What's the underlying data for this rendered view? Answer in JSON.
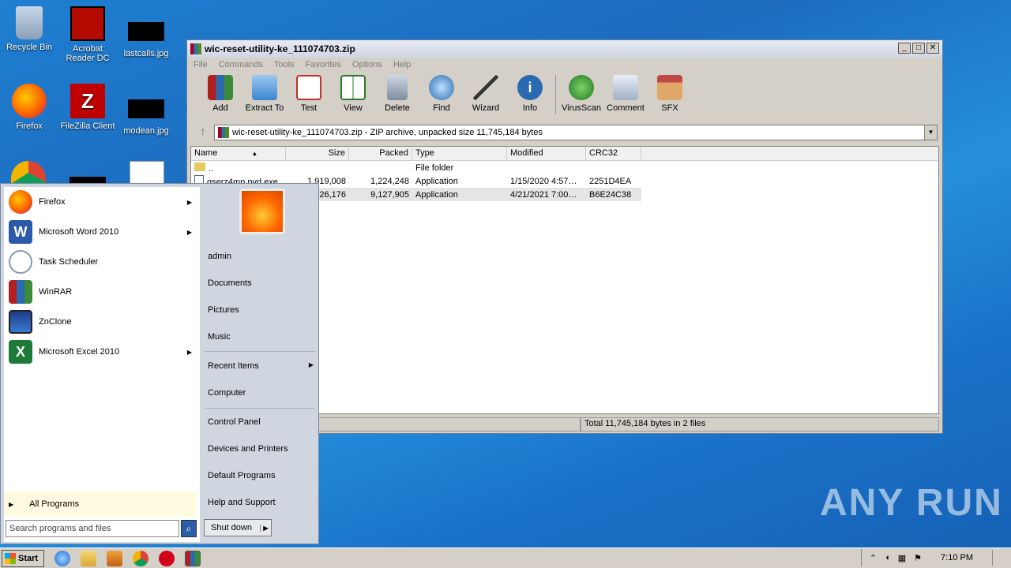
{
  "desktop": {
    "icons": [
      {
        "label": "Recycle Bin"
      },
      {
        "label": "Acrobat Reader DC"
      },
      {
        "label": "lastcalls.jpg"
      },
      {
        "label": "Firefox"
      },
      {
        "label": "FileZilla Client"
      },
      {
        "label": "modean.jpg"
      }
    ]
  },
  "window": {
    "title": "wic-reset-utility-ke_111074703.zip",
    "menu": [
      "File",
      "Commands",
      "Tools",
      "Favorites",
      "Options",
      "Help"
    ],
    "toolbar": [
      "Add",
      "Extract To",
      "Test",
      "View",
      "Delete",
      "Find",
      "Wizard",
      "Info",
      "VirusScan",
      "Comment",
      "SFX"
    ],
    "path": "wic-reset-utility-ke_111074703.zip - ZIP archive, unpacked size 11,745,184 bytes",
    "columns": [
      "Name",
      "Size",
      "Packed",
      "Type",
      "Modified",
      "CRC32"
    ],
    "rows": [
      {
        "name": "..",
        "size": "",
        "packed": "",
        "type": "File folder",
        "modified": "",
        "crc": ""
      },
      {
        "name": "qserz4mp.pyd.exe",
        "size": "1,919,008",
        "packed": "1,224,248",
        "type": "Application",
        "modified": "1/15/2020 4:57…",
        "crc": "2251D4EA"
      },
      {
        "name": "",
        "size": "…26,176",
        "packed": "9,127,905",
        "type": "Application",
        "modified": "4/21/2021 7:00…",
        "crc": "B6E24C38"
      }
    ],
    "status_left": "…s in 1 file",
    "status_right": "Total 11,745,184 bytes in 2 files"
  },
  "start_menu": {
    "programs": [
      {
        "label": "Firefox",
        "arrow": true
      },
      {
        "label": "Microsoft Word 2010",
        "arrow": true
      },
      {
        "label": "Task Scheduler",
        "arrow": false
      },
      {
        "label": "WinRAR",
        "arrow": false
      },
      {
        "label": "ZnClone",
        "arrow": false
      },
      {
        "label": "Microsoft Excel 2010",
        "arrow": true
      }
    ],
    "all_programs": "All Programs",
    "search_placeholder": "Search programs and files",
    "right": {
      "user": "admin",
      "documents": "Documents",
      "pictures": "Pictures",
      "music": "Music",
      "recent": "Recent Items",
      "computer": "Computer",
      "control_panel": "Control Panel",
      "devices": "Devices and Printers",
      "default_programs": "Default Programs",
      "help": "Help and Support"
    },
    "shutdown": "Shut down"
  },
  "taskbar": {
    "start": "Start",
    "clock": "7:10 PM"
  },
  "watermark": "ANY RUN"
}
